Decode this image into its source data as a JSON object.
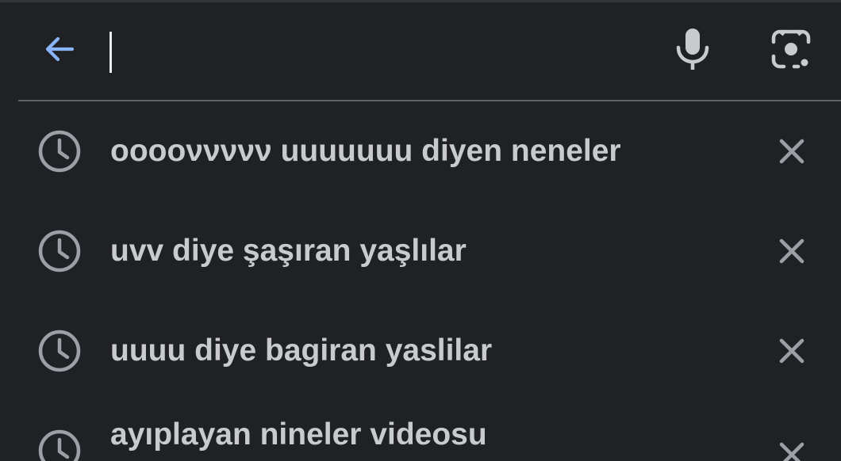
{
  "search": {
    "value": "",
    "placeholder": ""
  },
  "icons": {
    "back": "arrow-back-icon",
    "mic": "microphone-icon",
    "lens": "camera-lens-icon",
    "history": "clock-history-icon",
    "remove": "close-x-icon"
  },
  "colors": {
    "background": "#202124",
    "accent": "#8ab4f8",
    "text": "#c8cacd",
    "icon": "#9aa0a6",
    "divider": "#5f6368"
  },
  "suggestions": [
    {
      "label": "ooooννννν uuuuuuu diyen neneler"
    },
    {
      "label": "uvv diye şaşıran yaşlılar"
    },
    {
      "label": "uuuu diye bagiran yaslilar"
    },
    {
      "label": "ayıplayan nineler videosu"
    }
  ]
}
